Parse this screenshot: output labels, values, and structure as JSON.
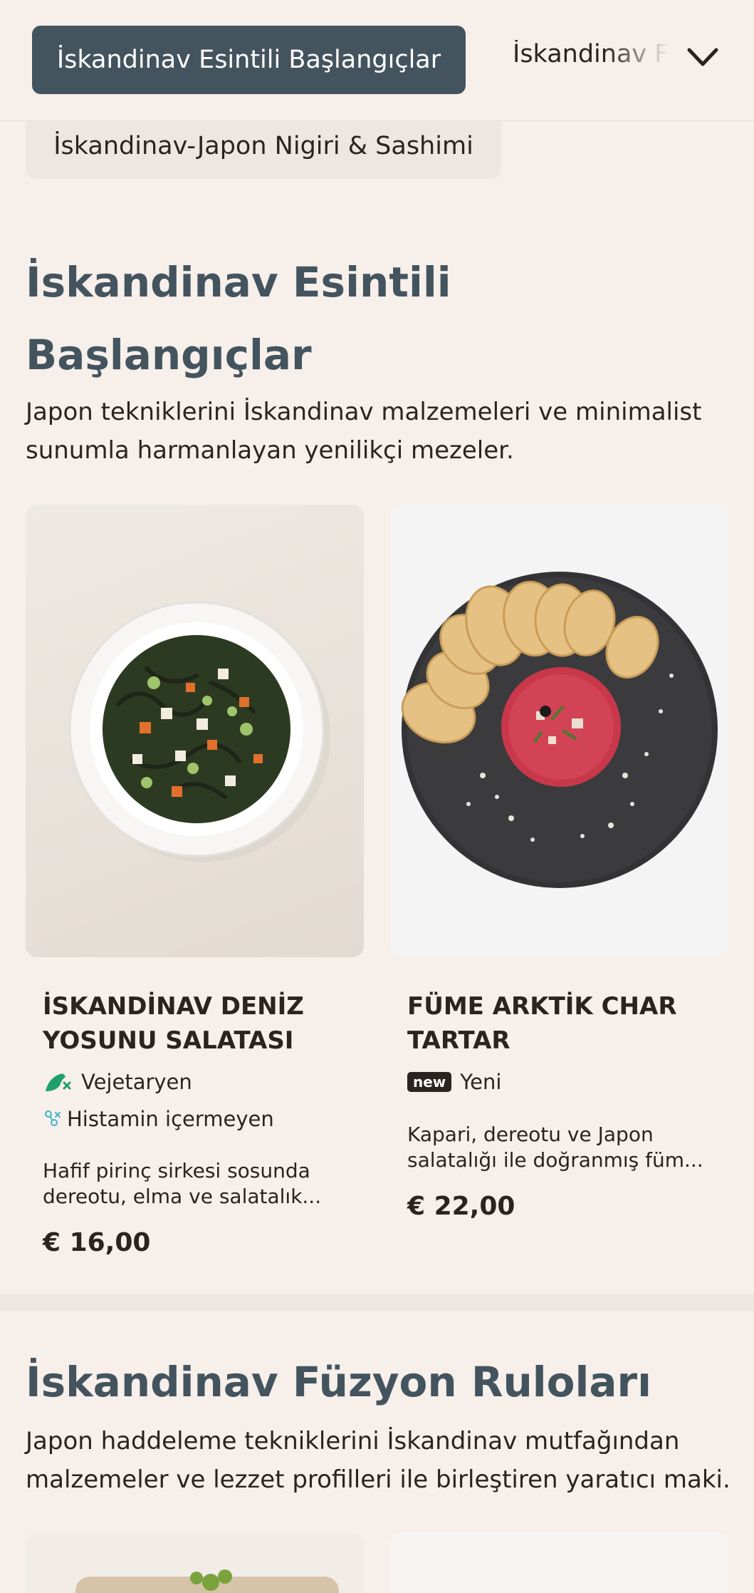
{
  "nav": {
    "active_tab": "İskandinav Esintili Başlangıçlar",
    "next_tab": "İskandinav Füzyon Ruloları",
    "sub_tab": "İskandinav-Japon Nigiri & Sashimi"
  },
  "section1": {
    "title_line1": "İskandinav Esintili",
    "title_line2": "Başlangıçlar",
    "description": "Japon tekniklerini İskandinav malzemeleri ve minimalist sunumla harmanlayan yenilikçi mezeler.",
    "items": [
      {
        "name_line1": "İSKANDİNAV DENİZ",
        "name_line2": "YOSUNU SALATASI",
        "tag1": "Vejetaryen",
        "tag2": "Histamin içermeyen",
        "desc_line1": "Hafif pirinç sirkesi sosunda",
        "desc_line2": "dereotu, elma ve salatalık...",
        "price": "€ 16,00"
      },
      {
        "name_line1": "FÜME ARKTİK CHAR",
        "name_line2": "TARTAR",
        "badge": "new",
        "tag1": "Yeni",
        "desc_line1": "Kapari, dereotu ve Japon",
        "desc_line2": "salatalığı ile doğranmış füm...",
        "price": "€ 22,00"
      }
    ]
  },
  "section2": {
    "title": "İskandinav Füzyon Ruloları",
    "description": "Japon haddeleme tekniklerini İskandinav mutfağından malzemeler ve lezzet profilleri ile birleştiren yaratıcı maki."
  },
  "colors": {
    "background": "#f6efea",
    "accent": "#44545e",
    "vegetarian_icon": "#1f9e6e",
    "histamine_icon": "#3fb3c9"
  },
  "icons": [
    "chevron-down-icon",
    "vegetarian-icon",
    "histamine-free-icon"
  ]
}
